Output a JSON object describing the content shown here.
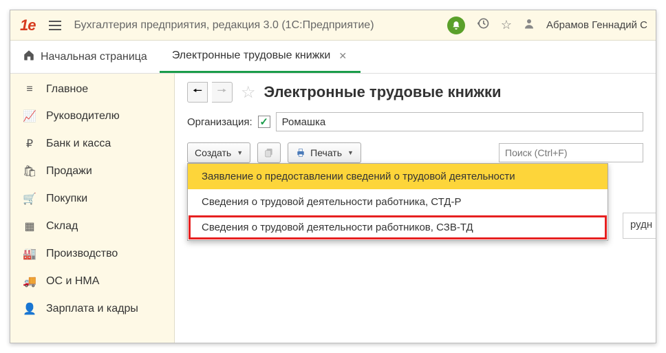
{
  "header": {
    "logo_text": "1C",
    "app_title": "Бухгалтерия предприятия, редакция 3.0  (1С:Предприятие)",
    "user_name": "Абрамов Геннадий С"
  },
  "tabs": {
    "home_label": "Начальная страница",
    "active_label": "Электронные трудовые книжки"
  },
  "sidebar": {
    "items": [
      {
        "icon": "≡",
        "label": "Главное"
      },
      {
        "icon": "📈",
        "label": "Руководителю"
      },
      {
        "icon": "₽",
        "label": "Банк и касса"
      },
      {
        "icon": "🛍",
        "label": "Продажи"
      },
      {
        "icon": "🛒",
        "label": "Покупки"
      },
      {
        "icon": "▦",
        "label": "Склад"
      },
      {
        "icon": "🏭",
        "label": "Производство"
      },
      {
        "icon": "🚚",
        "label": "ОС и НМА"
      },
      {
        "icon": "👤",
        "label": "Зарплата и кадры"
      }
    ]
  },
  "page": {
    "title": "Электронные трудовые книжки",
    "filter_label": "Организация:",
    "org_value": "Ромашка",
    "toolbar": {
      "create_label": "Создать",
      "print_label": "Печать",
      "search_placeholder": "Поиск (Ctrl+F)"
    },
    "create_menu": [
      "Заявление о предоставлении сведений о трудовой деятельности",
      "Сведения о трудовой деятельности работника, СТД-Р",
      "Сведения о трудовой деятельности работников, СЗВ-ТД"
    ],
    "table_col_frag": "рудн"
  }
}
